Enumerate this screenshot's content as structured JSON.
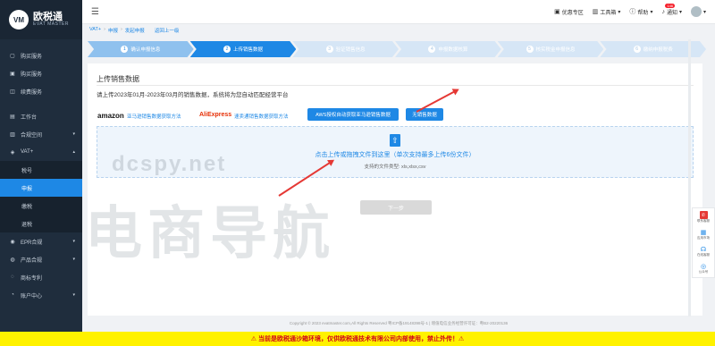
{
  "logo": {
    "name": "欧税通",
    "sub": "EVAT MASTER",
    "mark": "VM"
  },
  "sidebar": {
    "items": [
      {
        "label": "购买服务",
        "icon": "cart-icon"
      },
      {
        "label": "购买服务",
        "icon": "bag-icon"
      },
      {
        "label": "续费服务",
        "icon": "renew-icon"
      },
      {
        "label": "工作台",
        "icon": "desk-icon"
      },
      {
        "label": "合规空间",
        "icon": "folder-icon",
        "caret": "▾"
      },
      {
        "label": "VAT+",
        "icon": "vat-icon",
        "caret": "▴"
      }
    ],
    "sub_items": [
      {
        "label": "税号"
      },
      {
        "label": "申报"
      },
      {
        "label": "缴税"
      },
      {
        "label": "退税"
      }
    ],
    "bottom_items": [
      {
        "label": "EPR合规",
        "icon": "epr-icon",
        "caret": "▾"
      },
      {
        "label": "产品合规",
        "icon": "product-icon",
        "caret": "▾"
      },
      {
        "label": "商标专利",
        "icon": "trademark-icon"
      },
      {
        "label": "账户中心",
        "icon": "account-icon",
        "caret": "▾"
      }
    ]
  },
  "header": {
    "hamburger": "☰",
    "promo": "优惠专区",
    "tools": "工具箱",
    "help": "帮助",
    "notify": "通知",
    "notify_count": "146"
  },
  "breadcrumb": {
    "a": "VAT+",
    "b": "申报",
    "c": "发起申报",
    "back": "返回上一级"
  },
  "steps": [
    {
      "num": "1",
      "label": "确认申报信息"
    },
    {
      "num": "2",
      "label": "上传销售数据"
    },
    {
      "num": "3",
      "label": "验证销售信息"
    },
    {
      "num": "4",
      "label": "申报数据核算"
    },
    {
      "num": "5",
      "label": "核实税金申报信息"
    },
    {
      "num": "6",
      "label": "缴纳申报税费"
    }
  ],
  "main": {
    "title": "上传销售数据",
    "desc": "请上传2023年01月-2023年03月的销售数据，系统将为您自动匹配经营平台",
    "amazon_logo": "amazon",
    "amazon_link": "亚马逊销售数据获取方法",
    "ali_logo": "AliExpress",
    "ali_link": "速卖通销售数据获取方法",
    "btn_aws": "AWS授权自动获取亚马逊销售数据",
    "btn_nosale": "无销售数据",
    "upload_icon": "⇧",
    "drop_text": "点击上传或拖拽文件到这里（单次支持最多上传6份文件）",
    "drop_sub": "支持的文件类型: xls,xlsx,csv",
    "next": "下一步"
  },
  "watermark": {
    "url": "dcspy.net",
    "big": "电商导航"
  },
  "footer": {
    "copyright": "Copyright © 2023 evatmaster.com,All Rights Reserved 粤ICP备19148398号-1  |  增值电信业务经营许可证：粤B2-20220136"
  },
  "warning": "⚠ 当前是欧税通沙箱环境，仅供欧税通技术有限公司内部使用，禁止外传！⚠",
  "right_tools": [
    {
      "label": "联系客服",
      "icon": "chat-icon",
      "glyph": "✆"
    },
    {
      "label": "应用市场",
      "icon": "store-icon",
      "glyph": "▦"
    },
    {
      "label": "在线客服",
      "icon": "headset-icon",
      "glyph": "☊"
    },
    {
      "label": "公众号",
      "icon": "qrcode-icon",
      "glyph": "◎"
    }
  ],
  "colors": {
    "accent": "#1e88e5",
    "sidebar": "#1f2d3d",
    "warning_bg": "#fff200",
    "warning_text": "#d0021b"
  }
}
